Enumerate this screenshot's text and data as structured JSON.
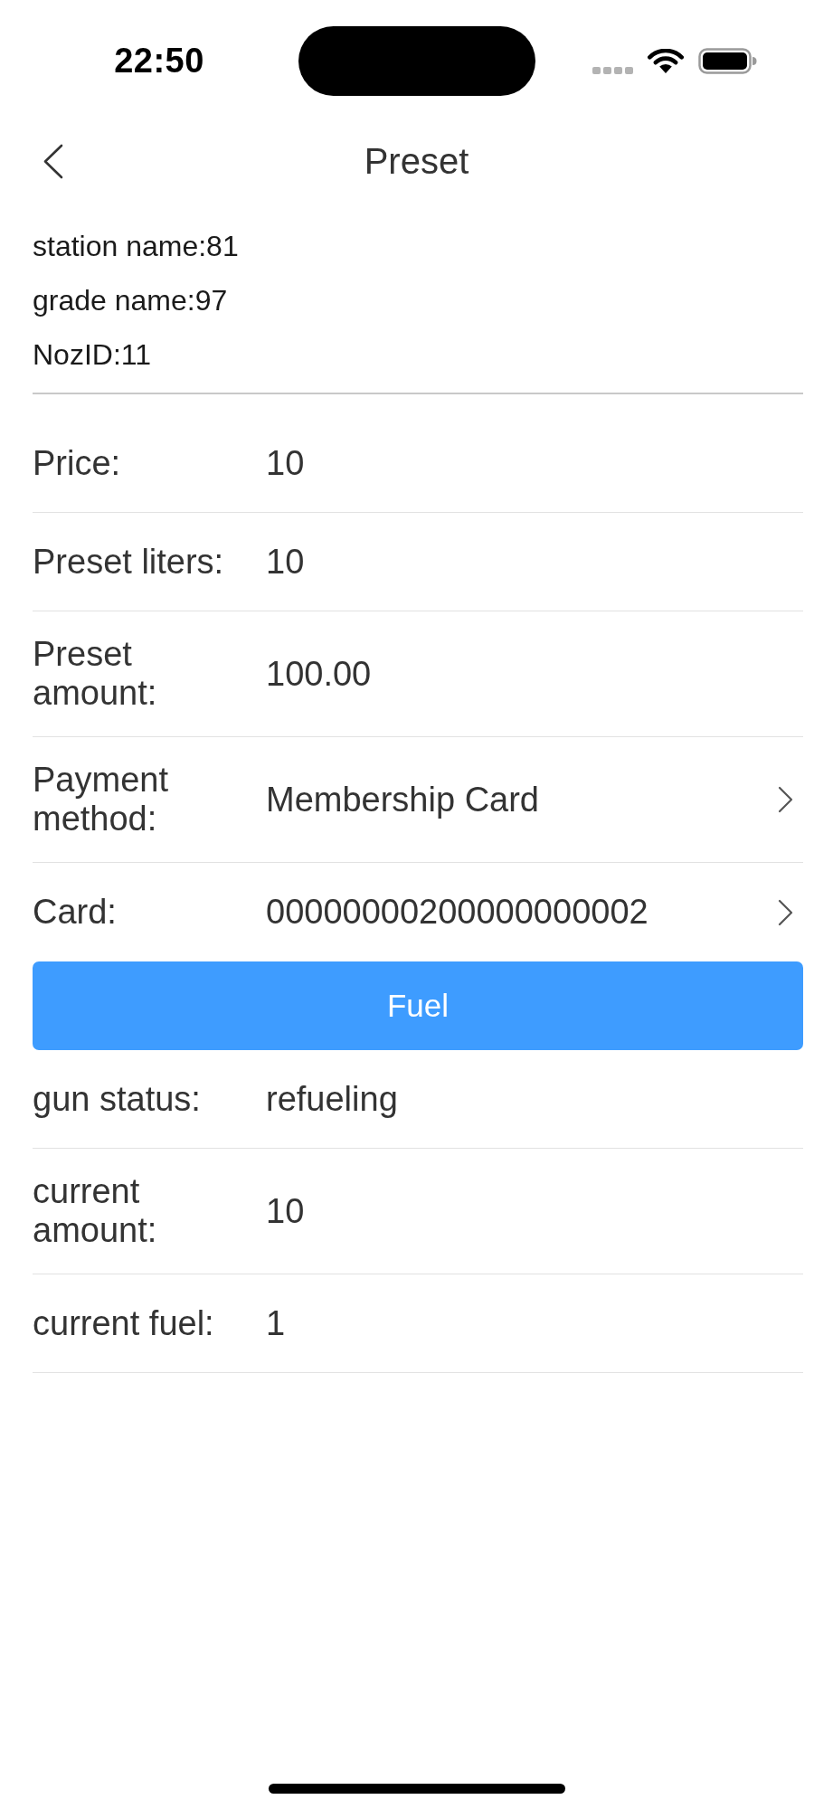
{
  "status_bar": {
    "time": "22:50"
  },
  "nav_bar": {
    "title": "Preset"
  },
  "station_info": [
    "station name:81",
    "grade name:97",
    "NozID:11"
  ],
  "preset_fields": [
    {
      "label": "Price:",
      "value": "10",
      "kind": "text"
    },
    {
      "label": "Preset liters:",
      "value": "10",
      "kind": "text"
    },
    {
      "label": "Preset amount:",
      "value": "100.00",
      "kind": "text"
    },
    {
      "label": "Payment method:",
      "value": "Membership Card",
      "kind": "select"
    },
    {
      "label": "Card:",
      "value": "00000000200000000002",
      "kind": "select"
    }
  ],
  "fuel_button": {
    "label": "Fuel"
  },
  "status_fields": [
    {
      "label": "gun status:",
      "value": "refueling"
    },
    {
      "label": "current amount:",
      "value": "10"
    },
    {
      "label": "current fuel:",
      "value": "1"
    }
  ]
}
